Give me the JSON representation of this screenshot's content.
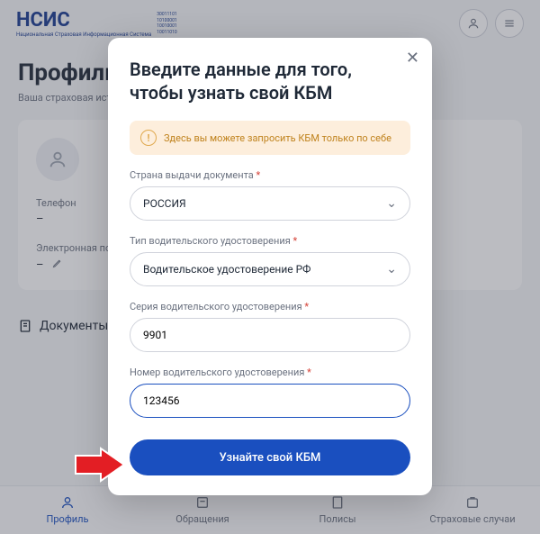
{
  "header": {
    "logo_text": "НСИС",
    "logo_lines": "30011101\n10100001\n10010001\n10011010",
    "logo_sub": "Национальная Страховая Информационная Система"
  },
  "page": {
    "title": "Профиль",
    "subtitle": "Ваша страховая история по данным АИС страхования на 11:56 01.01.2…"
  },
  "card": {
    "phone_label": "Телефон",
    "phone_value": "–",
    "email_label": "Электронная почта",
    "email_value": "–"
  },
  "tabs": {
    "profile": "Профиль",
    "requests": "Обращения",
    "policies": "Полисы",
    "cases": "Страховые случаи"
  },
  "modal": {
    "title": "Введите данные для того, чтобы узнать свой КБМ",
    "alert": "Здесь вы можете запросить КБМ только по себе",
    "country_label": "Страна выдачи документа",
    "country_value": "РОССИЯ",
    "type_label": "Тип водительского удостоверения",
    "type_value": "Водительское удостоверение РФ",
    "series_label": "Серия водительского удостоверения",
    "series_value": "9901",
    "number_label": "Номер водительского удостоверения",
    "number_value": "123456",
    "submit": "Узнайте свой КБМ"
  },
  "docs": {
    "label": "Документы"
  }
}
